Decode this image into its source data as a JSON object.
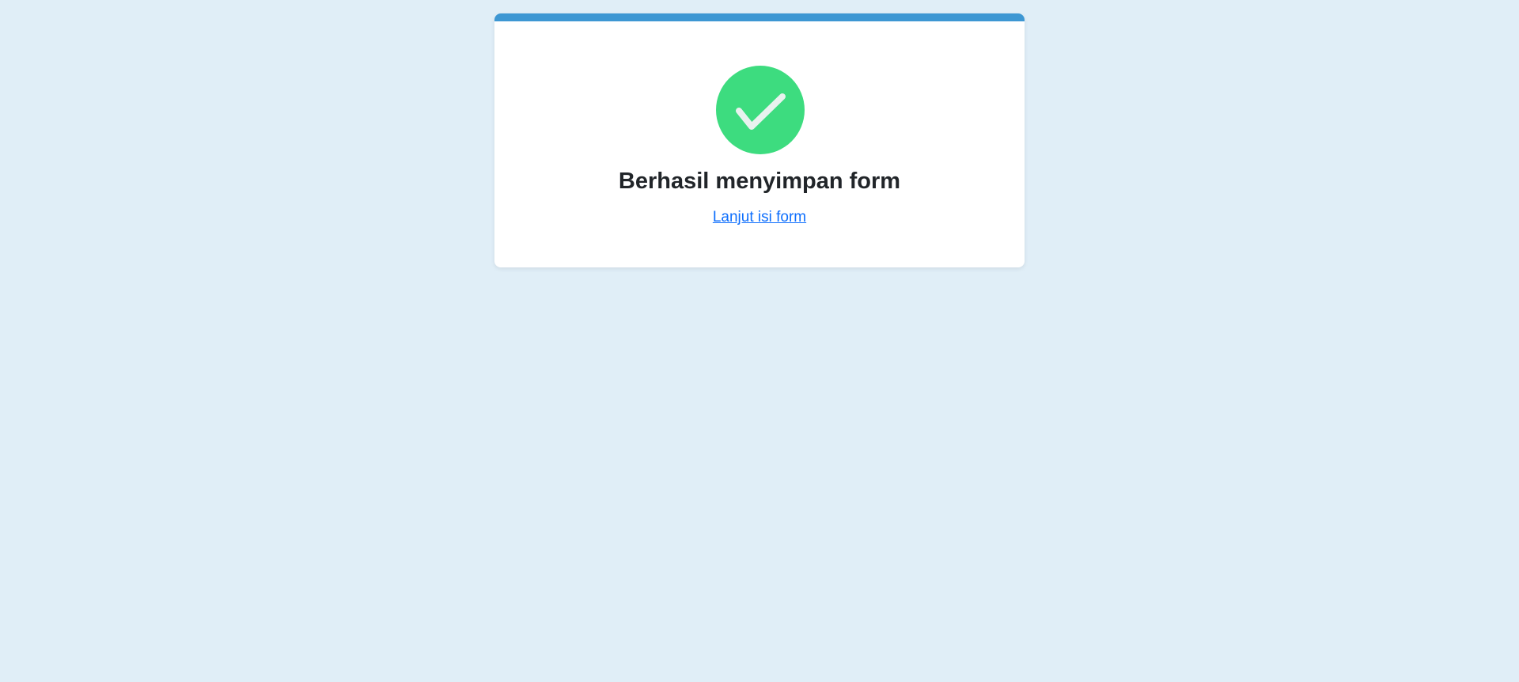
{
  "colors": {
    "page_background": "#e0eef7",
    "card_background": "#ffffff",
    "accent_bar": "#3d97d3",
    "success_circle": "#3ddc7f",
    "check_mark": "#e8f2ee",
    "title_text": "#212529",
    "link_text": "#0d6efd"
  },
  "card": {
    "icon": "check-circle-icon",
    "title": "Berhasil menyimpan form",
    "link_label": "Lanjut isi form"
  }
}
